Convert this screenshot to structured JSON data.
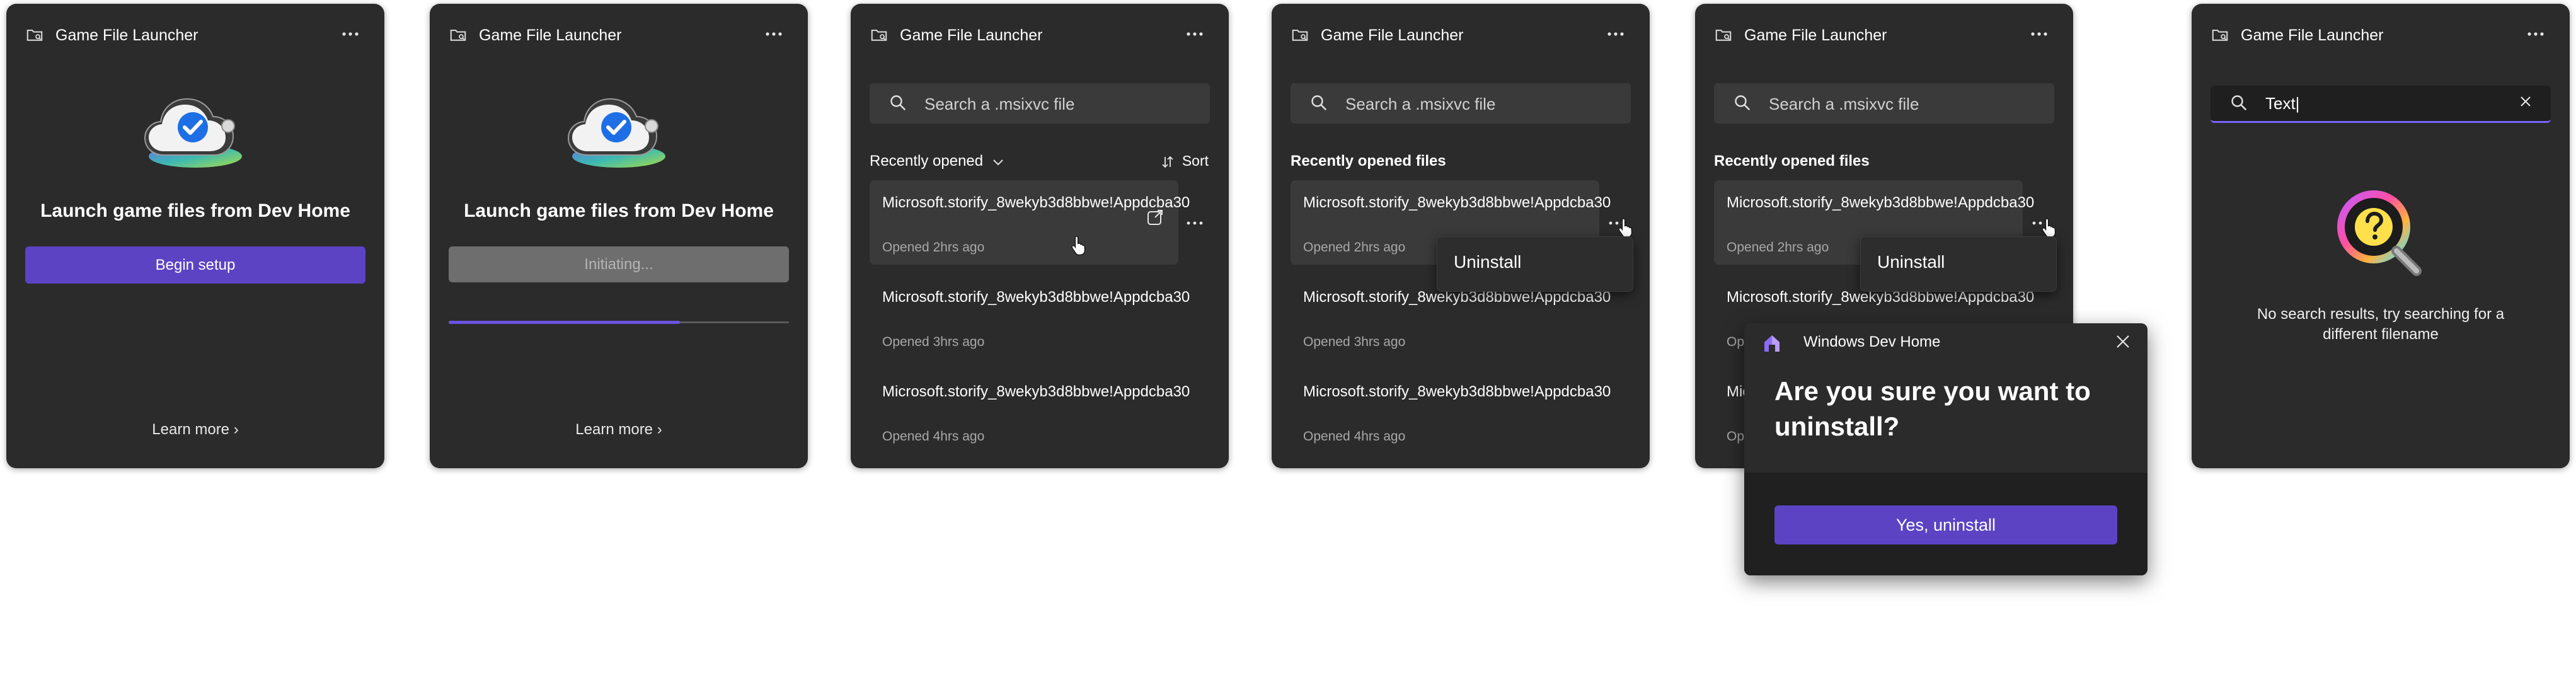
{
  "app_title": "Game File Launcher",
  "welcome": {
    "heading": "Launch game files from Dev Home",
    "setup_button": "Begin setup",
    "initiating_button": "Initiating...",
    "progress": 0.68,
    "learn_more": "Learn more"
  },
  "search": {
    "placeholder": "Search a .msixvc file",
    "typed_value": "Text|"
  },
  "recent": {
    "dropdown_label": "Recently opened",
    "sort_label": "Sort",
    "header_label": "Recently opened files",
    "files": [
      {
        "name": "Microsoft.storify_8wekyb3d8bbwe!Appdcba30",
        "opened": "Opened 2hrs ago"
      },
      {
        "name": "Microsoft.storify_8wekyb3d8bbwe!Appdcba30",
        "opened": "Opened 3hrs ago"
      },
      {
        "name": "Microsoft.storify_8wekyb3d8bbwe!Appdcba30",
        "opened": "Opened 4hrs ago"
      }
    ]
  },
  "context_menu": {
    "uninstall": "Uninstall"
  },
  "dialog": {
    "app_name": "Windows Dev Home",
    "question": "Are you sure you want to uninstall?",
    "confirm": "Yes, uninstall"
  },
  "empty_state": {
    "message": "No search results, try searching for a different filename"
  },
  "colors": {
    "accent": "#5b43c4",
    "card": "#2b2b2b",
    "progress": "#6b52e0"
  }
}
